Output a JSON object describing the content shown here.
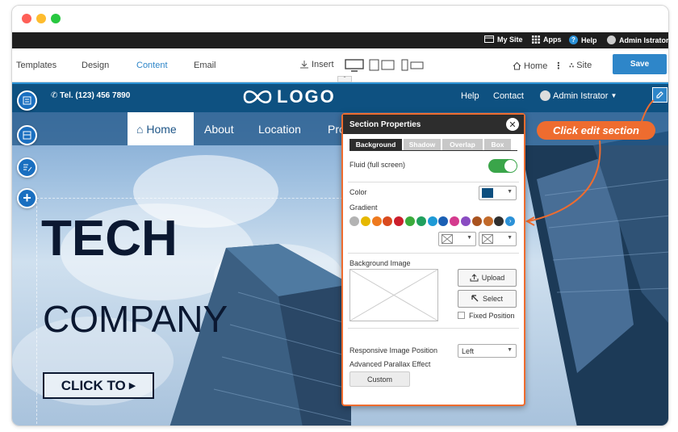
{
  "window": {
    "dot_colors": [
      "#fe5f57",
      "#febc2e",
      "#28c840"
    ]
  },
  "topbar": {
    "my_site": "My Site",
    "apps": "Apps",
    "help": "Help",
    "user": "Admin Istrator"
  },
  "toolbar": {
    "tabs": [
      "Templates",
      "Design",
      "Content",
      "Email"
    ],
    "insert": "Insert",
    "home": "Home",
    "site": "Site",
    "save": "Save",
    "accent": "#2e86c9"
  },
  "header": {
    "phone": "Tel. (123) 456 7890",
    "logo": "LOGO",
    "help": "Help",
    "contact": "Contact",
    "user": "Admin Istrator"
  },
  "nav": {
    "items": [
      "Home",
      "About",
      "Location",
      "Pro"
    ],
    "active": "Home"
  },
  "hero": {
    "title": "TECH",
    "subtitle": "COMPANY",
    "cta": "CLICK TO"
  },
  "callout": {
    "text": "Click edit section",
    "color": "#ee6c2f"
  },
  "panel": {
    "title": "Section Properties",
    "tabs": [
      "Background",
      "Shadow",
      "Overlap",
      "Box"
    ],
    "fluid_label": "Fluid (full screen)",
    "color_label": "Color",
    "color_value": "#0e4f7f",
    "gradient_label": "Gradient",
    "gradient_swatches": [
      "#b3b3b3",
      "#e6b800",
      "#ee7a1e",
      "#d94a1e",
      "#cc1e2c",
      "#3bab3b",
      "#20a05e",
      "#1e9ad6",
      "#1a5fb4",
      "#d43b8e",
      "#8a4cc2",
      "#a9531f",
      "#c26a2a",
      "#2f2f2f",
      "#2b91d7"
    ],
    "bgimage_label": "Background Image",
    "upload": "Upload",
    "select": "Select",
    "fixed_position": "Fixed Position",
    "responsive_label": "Responsive Image Position",
    "responsive_value": "Left",
    "parallax_label": "Advanced Parallax Effect",
    "custom": "Custom"
  }
}
